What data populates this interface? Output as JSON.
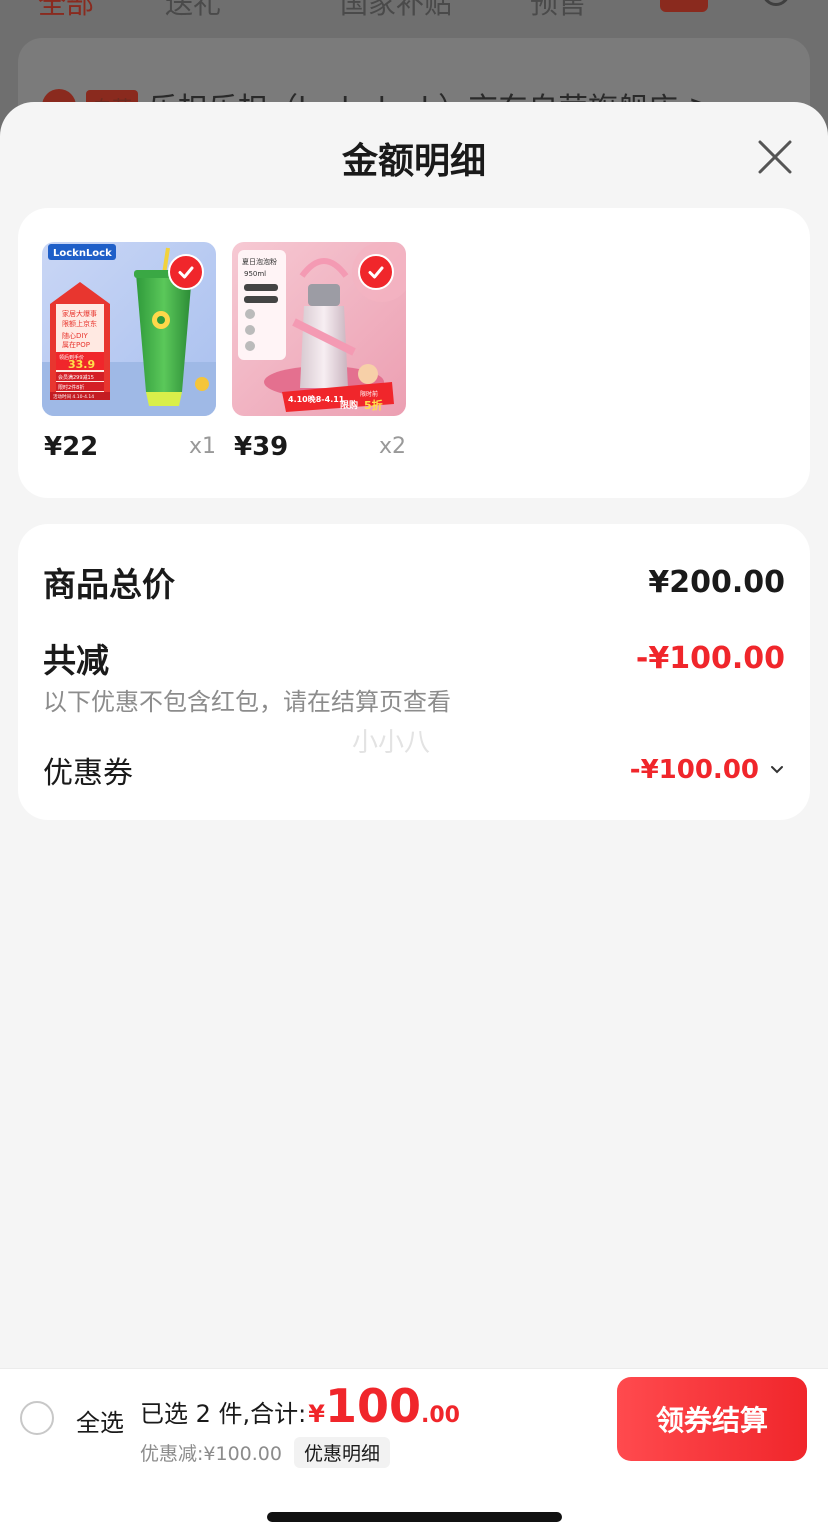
{
  "background": {
    "tabs": [
      "全部",
      "送礼",
      "国家补贴",
      "预售"
    ],
    "store_tag": "自营",
    "store_name": "乐扣乐扣（locknlock）京东自营旗舰店",
    "store_chevron": ">"
  },
  "sheet": {
    "title": "金额明细"
  },
  "products": [
    {
      "price": "¥22",
      "qty": "x1",
      "brand_tag": "LocknLock",
      "promo_lines": [
        "家居大爆事",
        "限额上京东",
        "随心DIY",
        "属在POP",
        "领后到手价"
      ],
      "promo_price": "33.9",
      "promo_sub": [
        "会员满299减15",
        "限时2件8折"
      ],
      "promo_date": "活动时间 4.10-4.14",
      "accent": "#f0262b"
    },
    {
      "price": "¥39",
      "qty": "x2",
      "label_top": "夏日泡泡粉",
      "label_cap": "950ml",
      "promo_date": "4.10晚8-4.11",
      "promo_flag": "限时前",
      "promo_discount": "5折",
      "promo_discount_prefix": "限购",
      "accent": "#f0262b"
    }
  ],
  "summary": {
    "total_label": "商品总价",
    "total_amount": "¥200.00",
    "reduce_label": "共减",
    "reduce_amount": "-¥100.00",
    "note": "以下优惠不包含红包，请在结算页查看",
    "watermark": "小小八",
    "coupon_label": "优惠券",
    "coupon_amount": "-¥100.00"
  },
  "bottom_bar": {
    "select_all": "全选",
    "selected_text": "已选 2 件,合计:",
    "currency": "¥",
    "total_int": "100",
    "total_dec": ".00",
    "discount_text": "优惠减:¥100.00",
    "detail_button": "优惠明细",
    "checkout_button": "领券结算"
  },
  "colors": {
    "accent_red": "#f0262b",
    "sheet_bg": "#f5f5f5"
  }
}
